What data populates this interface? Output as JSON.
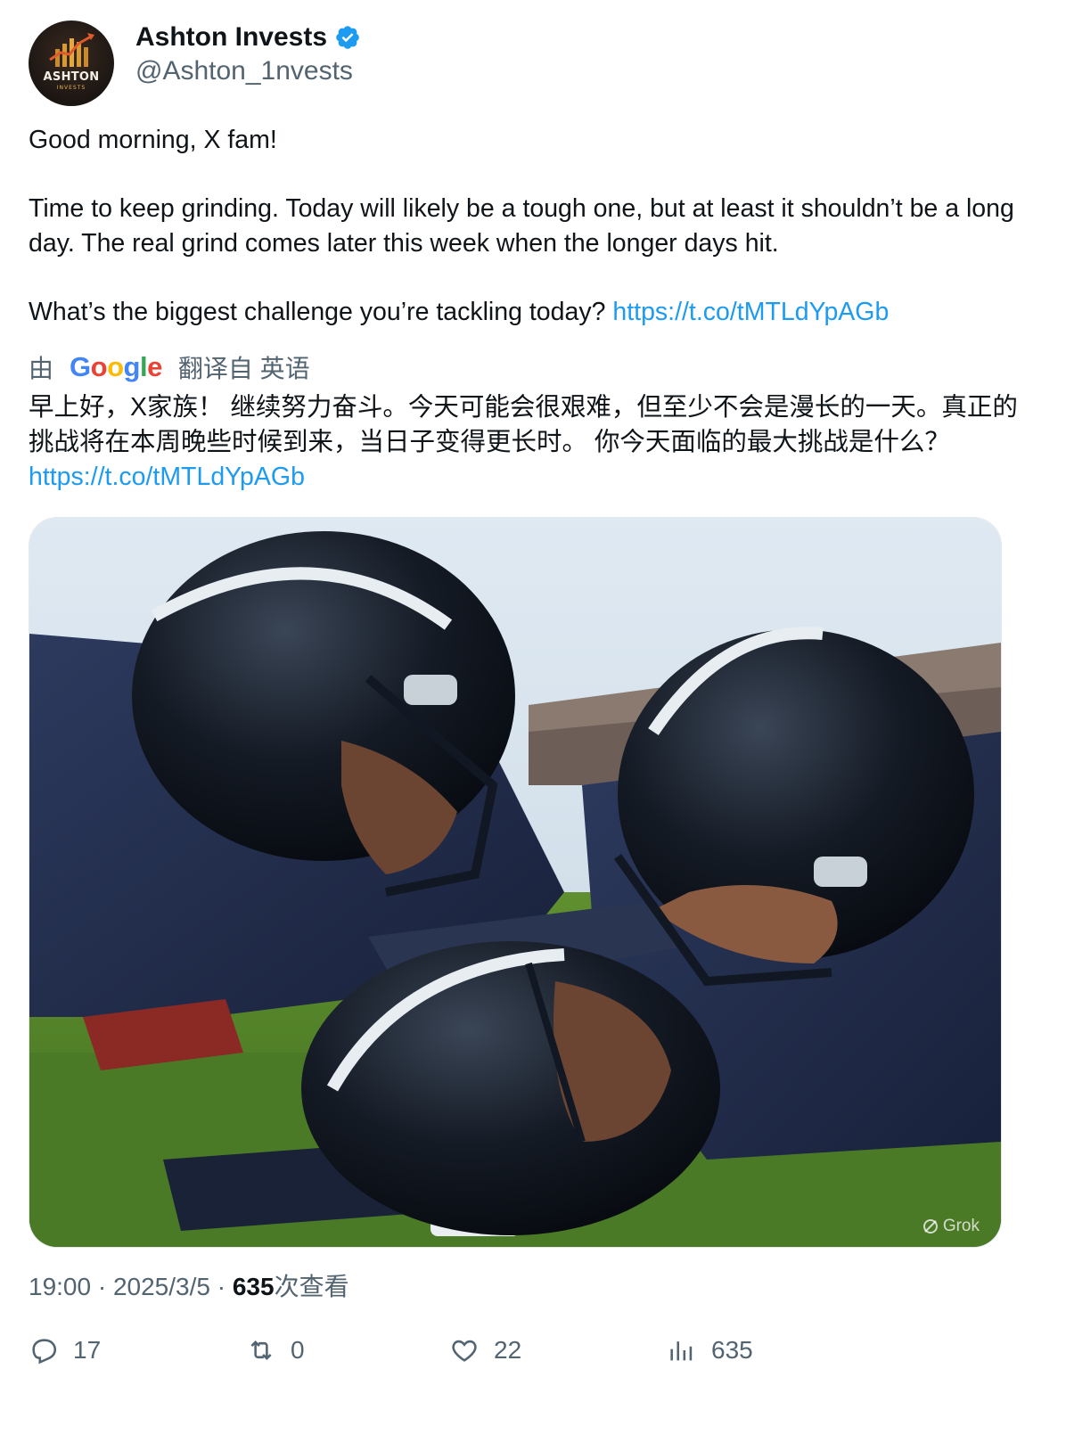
{
  "author": {
    "display_name": "Ashton Invests",
    "handle": "@Ashton_1nvests",
    "avatar_text": "ASHTON",
    "avatar_subtext": "INVESTS",
    "verified": true
  },
  "tweet": {
    "line1": "Good morning, X fam!",
    "line2": "Time to keep grinding. Today will likely be a tough one, but at least it shouldn’t be a long day. The real grind comes later this week when the longer days hit.",
    "line3": "What’s the biggest challenge you’re tackling today?",
    "link": "https://t.co/tMTLdYpAGb"
  },
  "translation": {
    "prefix": "由",
    "provider": "Google",
    "suffix": "翻译自 英语",
    "text": "早上好，X家族！ 继续努力奋斗。今天可能会很艰难，但至少不会是漫长的一天。真正的挑战将在本周晚些时候到来，当日子变得更长时。 你今天面临的最大挑战是什么？",
    "link": "https://t.co/tMTLdYpAGb"
  },
  "media": {
    "watermark": "Grok"
  },
  "meta": {
    "time": "19:00",
    "separator": "·",
    "date": "2025/3/5",
    "views_count": "635",
    "views_label": "次查看"
  },
  "actions": {
    "replies": "17",
    "reposts": "0",
    "likes": "22",
    "views": "635"
  },
  "colors": {
    "link": "#1d9bf0",
    "secondary_text": "#536471",
    "verified": "#1d9bf0"
  }
}
